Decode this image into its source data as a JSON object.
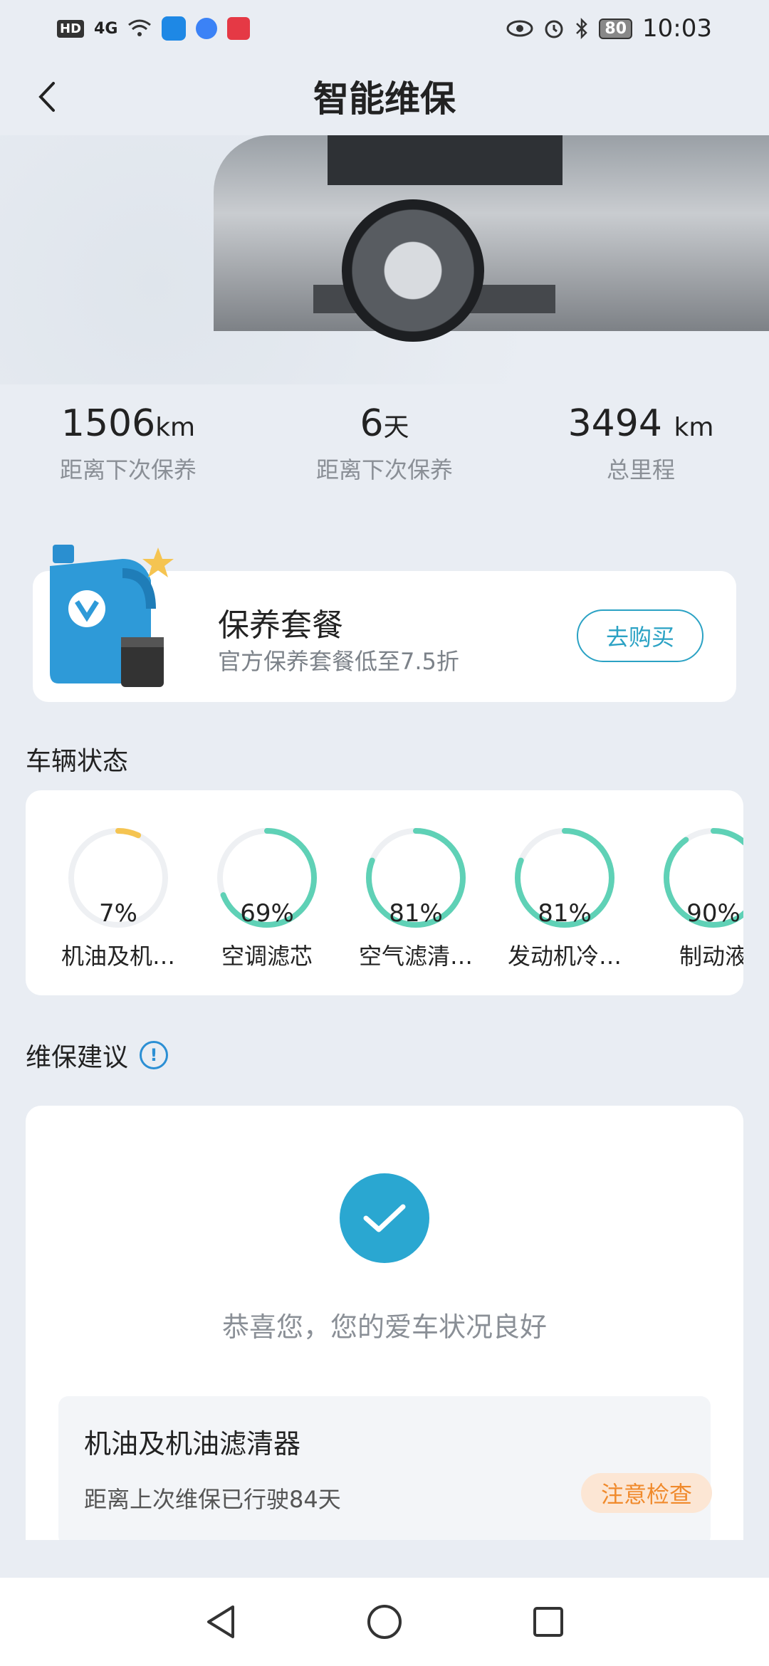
{
  "status_bar": {
    "hd": "HD",
    "signal": "4G",
    "battery": "80",
    "time": "10:03"
  },
  "header": {
    "title": "智能维保"
  },
  "stats": [
    {
      "value": "1506",
      "unit": "km",
      "label": "距离下次保养"
    },
    {
      "value": "6",
      "unit": "天",
      "label": "距离下次保养"
    },
    {
      "value": "3494 ",
      "unit": "km",
      "label": "总里程"
    }
  ],
  "package": {
    "title": "保养套餐",
    "subtitle": "官方保养套餐低至7.5折",
    "button": "去购买"
  },
  "vehicle_status": {
    "title": "车辆状态",
    "gauges": [
      {
        "percent": 7,
        "label_text": "7%",
        "name": "机油及机…",
        "color": "#f5c451"
      },
      {
        "percent": 69,
        "label_text": "69%",
        "name": "空调滤芯",
        "color": "#5fd1b6"
      },
      {
        "percent": 81,
        "label_text": "81%",
        "name": "空气滤清…",
        "color": "#5fd1b6"
      },
      {
        "percent": 81,
        "label_text": "81%",
        "name": "发动机冷…",
        "color": "#5fd1b6"
      },
      {
        "percent": 90,
        "label_text": "90%",
        "name": "制动液",
        "color": "#5fd1b6"
      }
    ]
  },
  "suggestion": {
    "title": "维保建议",
    "good_text": "恭喜您，您的爱车状况良好",
    "item": {
      "title": "机油及机油滤清器",
      "desc": "距离上次维保已行驶84天",
      "badge": "注意检查"
    }
  },
  "colors": {
    "accent": "#2aa7d1",
    "warning": "#f08a2c"
  }
}
